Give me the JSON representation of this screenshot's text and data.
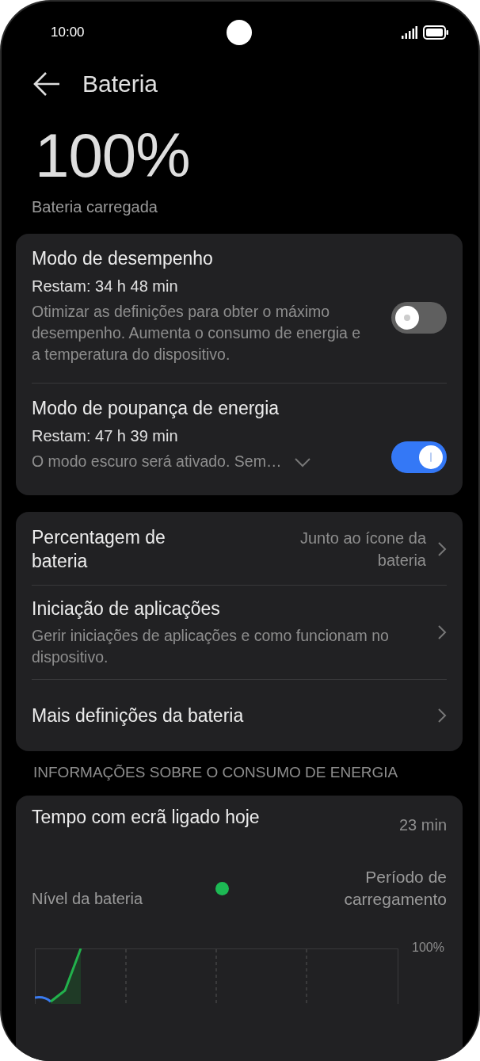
{
  "status_bar": {
    "time": "10:00"
  },
  "header": {
    "title": "Bateria"
  },
  "battery": {
    "percent": "100%",
    "status": "Bateria carregada"
  },
  "modes": [
    {
      "title": "Modo de desempenho",
      "remaining": "Restam: 34 h 48 min",
      "description": "Otimizar as definições para obter o máximo desempenho. Aumenta o consumo de energia e a temperatura do dispositivo.",
      "on": false
    },
    {
      "title": "Modo de poupança de energia",
      "remaining": "Restam: 47 h 39 min",
      "description": "O modo escuro será ativado. Sem…",
      "on": true,
      "expanded": false
    }
  ],
  "settings": [
    {
      "title": "Percentagem de bateria",
      "value": "Junto ao ícone da bateria"
    },
    {
      "title": "Iniciação de aplicações",
      "description": "Gerir iniciações de aplicações e como funcionam no dispositivo."
    },
    {
      "title": "Mais definições da bateria"
    }
  ],
  "section_header": "INFORMAÇÕES SOBRE O CONSUMO DE ENERGIA",
  "usage": {
    "title": "Tempo com ecrã ligado hoje",
    "value": "23 min",
    "legend": [
      "Nível da bateria",
      "Período de carregamento"
    ],
    "chart_y_label": "100%"
  }
}
